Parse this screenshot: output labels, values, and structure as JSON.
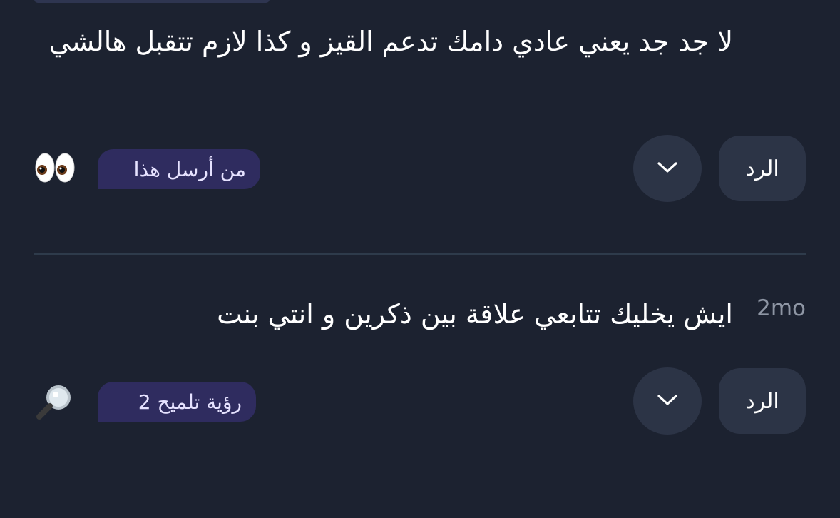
{
  "messages": [
    {
      "text": "لا جد جد يعني عادي دامك تدعم القيز و كذا لازم تتقبل هالشي",
      "timestamp": "",
      "reply_label": "الرد",
      "pill_label": "من أرسل هذا",
      "emoji_icon": "eyes-icon"
    },
    {
      "text": "ايش يخليك تتابعي علاقة بين ذكرين و انتي بنت",
      "timestamp": "2mo",
      "reply_label": "الرد",
      "pill_label": "رؤية تلميح 2",
      "emoji_icon": "magnifying-glass-icon"
    }
  ],
  "colors": {
    "background": "#1c2230",
    "button": "#2c3446",
    "pill": "#2f2c5f",
    "pill_text": "#e6e2ff",
    "timestamp": "#8e96a4",
    "divider": "#2e3b4b"
  }
}
